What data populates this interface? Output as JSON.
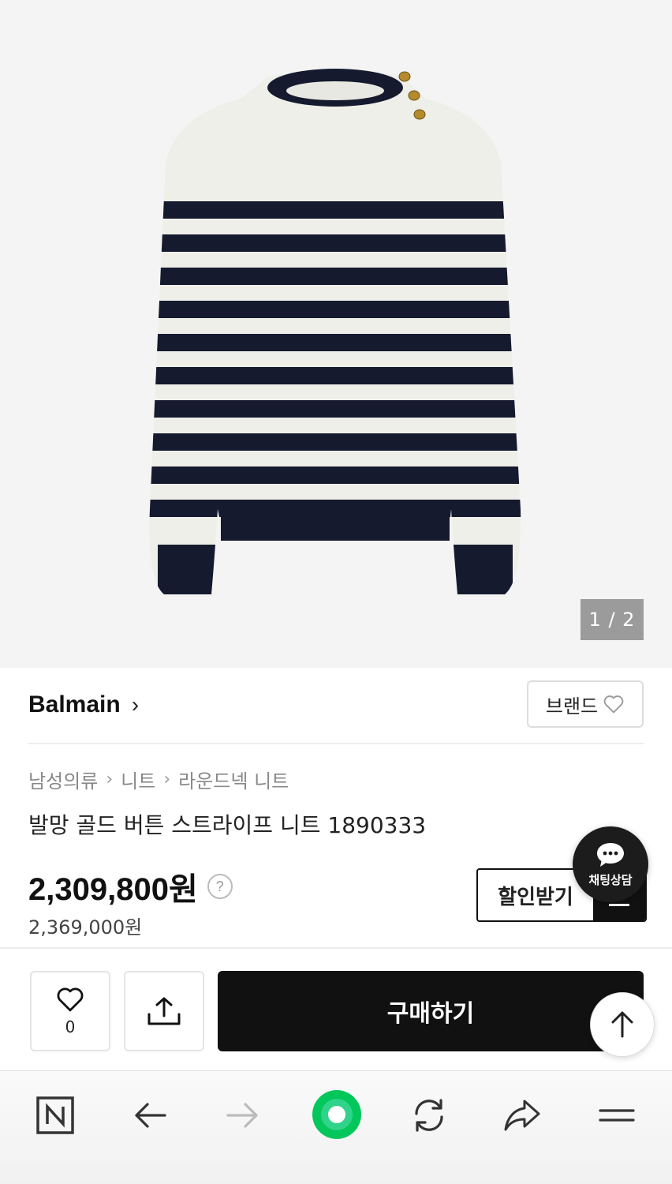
{
  "gallery": {
    "page_indicator": "1 / 2",
    "image_icon": "striped-sweater-image"
  },
  "brand": {
    "name": "Balmain",
    "button_label": "브랜드"
  },
  "breadcrumb": [
    "남성의류",
    "니트",
    "라운드넥 니트"
  ],
  "product": {
    "title": "발망 골드 버튼 스트라이프 니트 1890333",
    "price": "2,309,800원",
    "original_price": "2,369,000원",
    "discount_button": "할인받기"
  },
  "chat": {
    "label": "채팅상담"
  },
  "actions": {
    "like_count": "0",
    "buy_label": "구매하기"
  },
  "colors": {
    "accent": "#111111",
    "gallery_bg": "#f4f4f5",
    "naver_green": "#03c75a"
  }
}
